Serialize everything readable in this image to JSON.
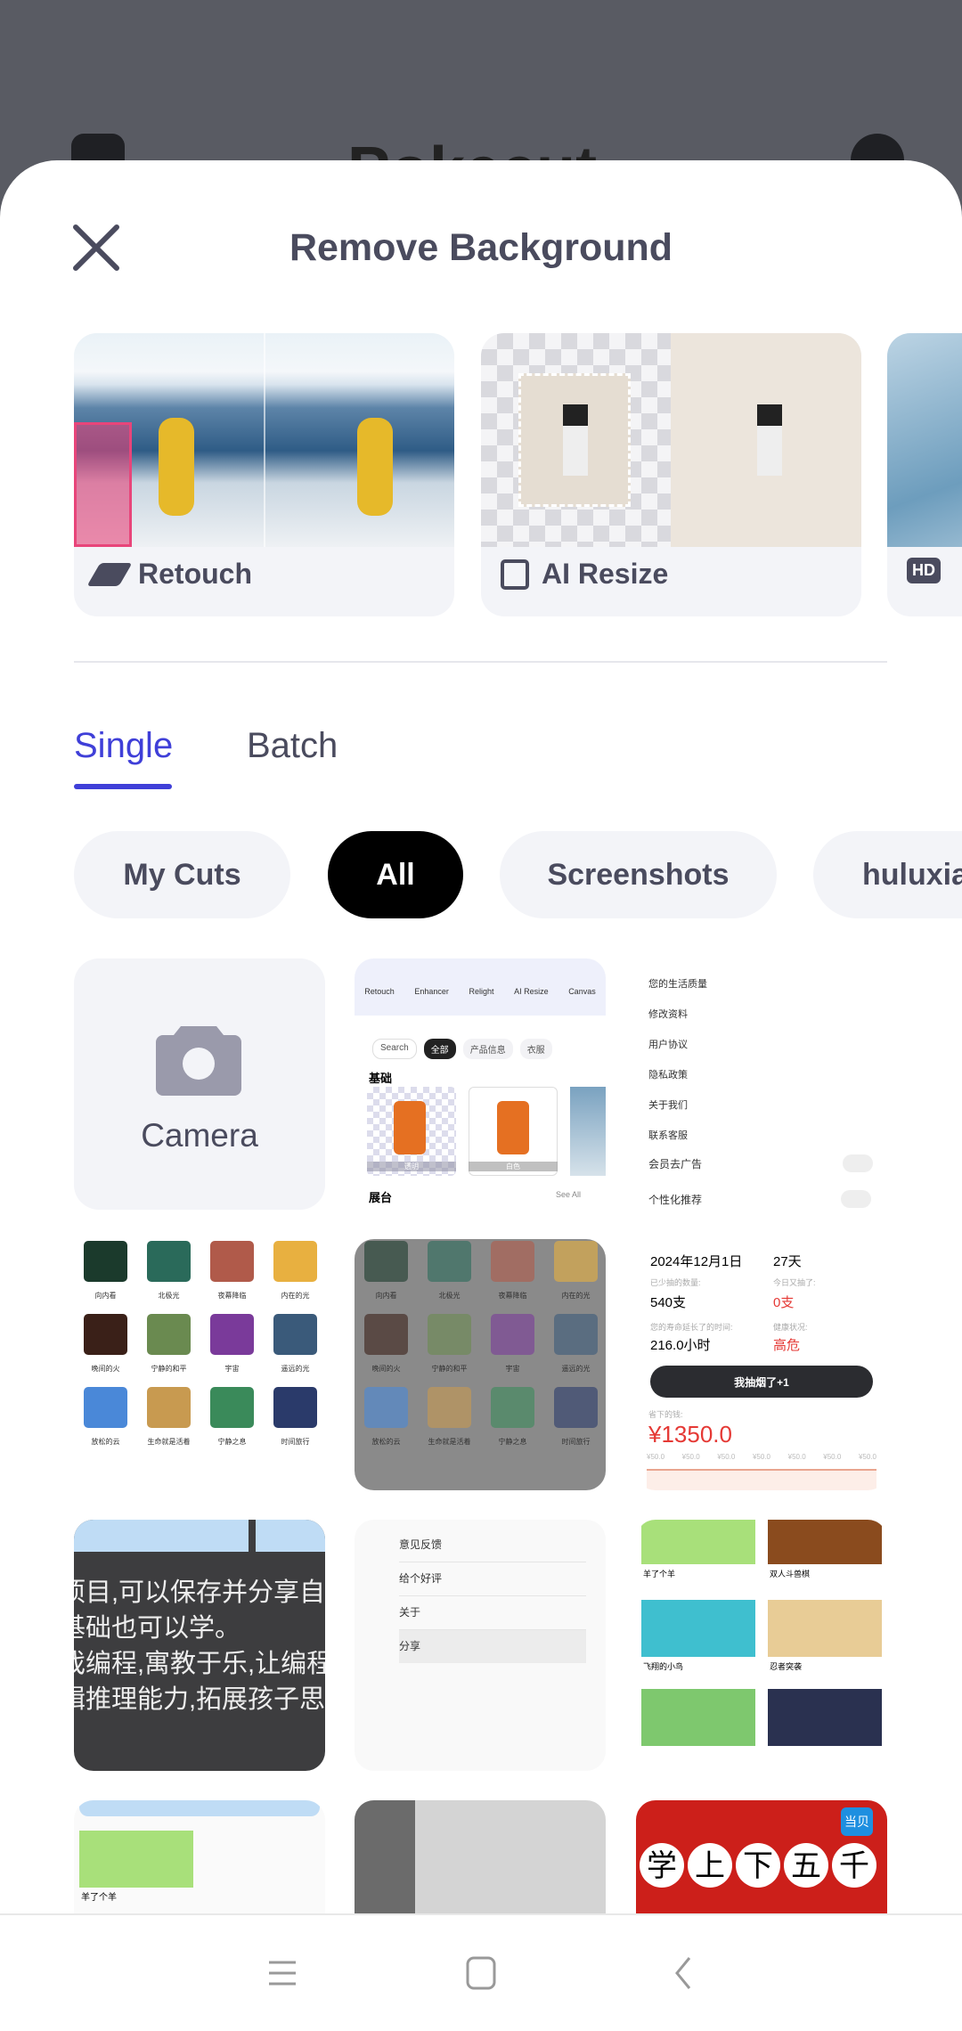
{
  "background_app": {
    "logo": "Pokecut"
  },
  "header": {
    "title": "Remove Background",
    "close_icon": "close-icon"
  },
  "features": [
    {
      "label": "Retouch",
      "icon": "eraser-icon"
    },
    {
      "label": "AI Resize",
      "icon": "ai-resize-icon"
    },
    {
      "label": "HD",
      "icon": "hd-icon"
    }
  ],
  "tabs": [
    {
      "label": "Single",
      "active": true
    },
    {
      "label": "Batch",
      "active": false
    }
  ],
  "albums": [
    {
      "label": "My Cuts",
      "selected": false
    },
    {
      "label": "All",
      "selected": true
    },
    {
      "label": "Screenshots",
      "selected": false
    },
    {
      "label": "huluxia",
      "selected": false
    }
  ],
  "camera_tile": {
    "label": "Camera",
    "icon": "camera-icon"
  },
  "thumbs": {
    "app_tools": [
      "Retouch",
      "Enhancer",
      "Relight",
      "AI Resize",
      "Canvas"
    ],
    "app_search": "Search",
    "app_chips": [
      "全部",
      "产品信息",
      "衣服"
    ],
    "app_section1": "基础",
    "app_items": [
      "透明",
      "白色"
    ],
    "app_section2": "展台",
    "app_see_all": "See All",
    "settings": [
      "您的生活质量",
      "修改资料",
      "用户协议",
      "隐私政策",
      "关于我们",
      "联系客服"
    ],
    "toggles": [
      "会员去广告",
      "个性化推荐"
    ],
    "photos": [
      "向内看",
      "北极光",
      "夜幕降临",
      "内在的光",
      "晚间的火",
      "宁静的和平",
      "宇宙",
      "遥远的光",
      "放松的云",
      "生命就是活着",
      "宁静之息",
      "时间旅行"
    ],
    "smoke": {
      "date": "2024年12月1日",
      "days": "27天",
      "l1": "已少抽的数量:",
      "v1": "540支",
      "l2": "今日又抽了:",
      "v2": "0支",
      "l3": "您的寿命延长了的时间:",
      "v3": "216.0小时",
      "l4": "健康状况:",
      "v4": "高危",
      "button": "我抽烟了+1",
      "l5": "省下的钱:",
      "money": "¥1350.0",
      "tick": "¥50.0"
    },
    "text_lines": [
      "项目,可以保存并分享自",
      "基础也可以学。",
      "戏编程,寓教于乐,让编程",
      "辑推理能力,拓展孩子思"
    ],
    "menu": [
      "意见反馈",
      "给个好评",
      "关于",
      "分享"
    ],
    "games": [
      "羊了个羊",
      "双人斗兽棋",
      "飞翔的小鸟",
      "忍者突袭"
    ],
    "game2": "羊了个羊",
    "poster_text": "学上下五千",
    "poster_badge": "当贝"
  },
  "navbar": {
    "menu": "menu-icon",
    "home": "home-icon",
    "back": "back-icon"
  },
  "colors": {
    "accent": "#3f3fd8",
    "text": "#4a4b5e",
    "chip_bg": "#f3f4f8",
    "danger": "#e53935"
  }
}
